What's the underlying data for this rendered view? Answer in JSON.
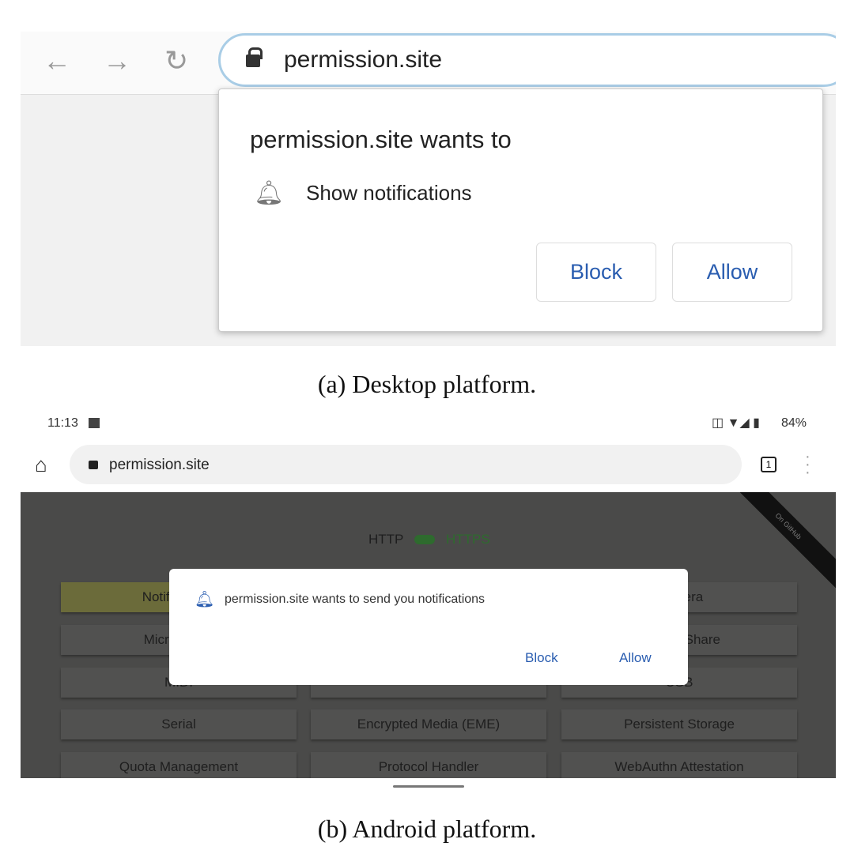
{
  "desktop": {
    "nav": {
      "back_icon": "arrow-left",
      "forward_icon": "arrow-right",
      "reload_icon": "reload"
    },
    "url": "permission.site",
    "prompt": {
      "title": "permission.site wants to",
      "permission": "Show notifications",
      "block": "Block",
      "allow": "Allow"
    },
    "caption": "(a) Desktop platform."
  },
  "android": {
    "status": {
      "time": "11:13",
      "battery": "84%"
    },
    "url": "permission.site",
    "tab_count": "1",
    "toggle": {
      "left": "HTTP",
      "right": "HTTPS"
    },
    "ribbon": "On GitHub",
    "buttons": [
      [
        "Notifications",
        "",
        "Camera"
      ],
      [
        "Microphone",
        "",
        "Screen Share"
      ],
      [
        "MIDI",
        "",
        "USB"
      ],
      [
        "Serial",
        "Encrypted Media (EME)",
        "Persistent Storage"
      ],
      [
        "Quota Management",
        "Protocol Handler",
        "WebAuthn Attestation"
      ]
    ],
    "dialog": {
      "message": "permission.site wants to send you notifications",
      "block": "Block",
      "allow": "Allow"
    },
    "caption": "(b) Android platform."
  },
  "colors": {
    "accent": "#2a5db0",
    "highlight": "#6b6b3a",
    "https_green": "#2e6b2e"
  }
}
